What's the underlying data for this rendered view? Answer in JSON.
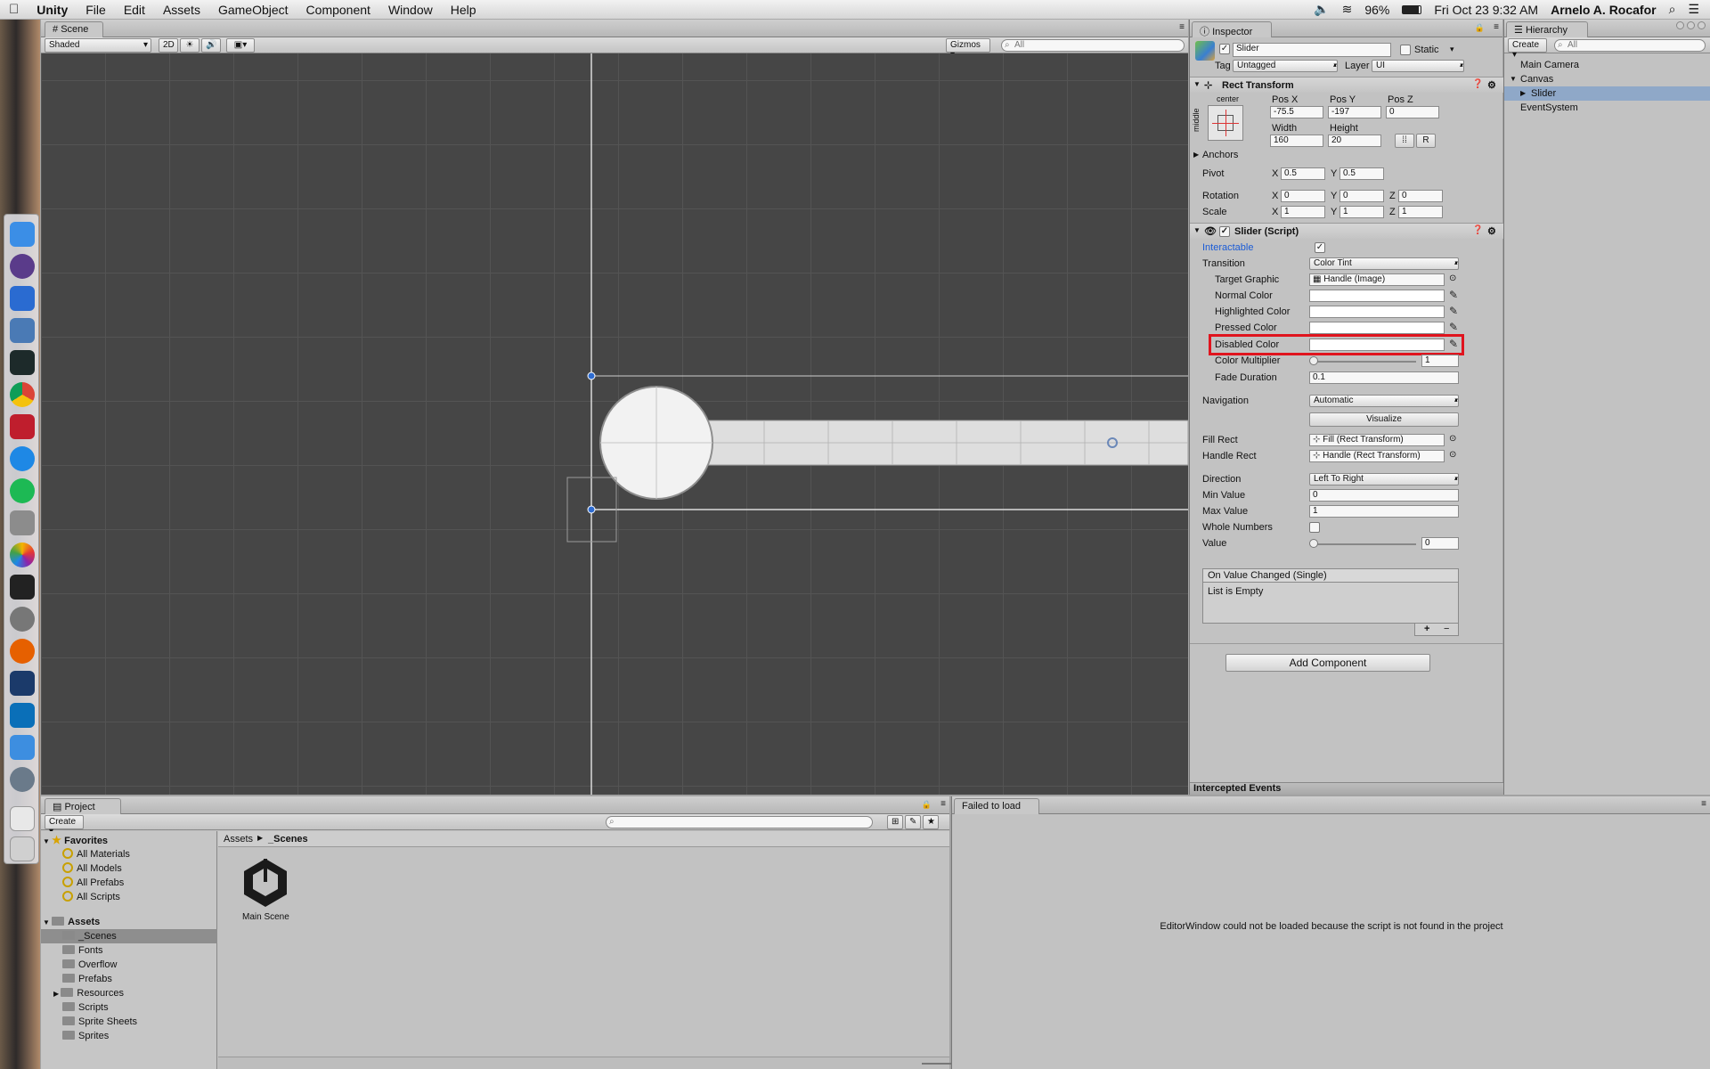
{
  "menubar": {
    "apple": "",
    "app": "Unity",
    "items": [
      "File",
      "Edit",
      "Assets",
      "GameObject",
      "Component",
      "Window",
      "Help"
    ],
    "battery": "96%",
    "datetime": "Fri Oct 23  9:32 AM",
    "user": "Arnelo A. Rocafor"
  },
  "scene": {
    "tab": "Scene",
    "shading": "Shaded",
    "mode_2d": "2D",
    "gizmos": "Gizmos",
    "search_placeholder": "All"
  },
  "inspector": {
    "tab": "Inspector",
    "object_name": "Slider",
    "static_label": "Static",
    "tag_label": "Tag",
    "tag_value": "Untagged",
    "layer_label": "Layer",
    "layer_value": "UI",
    "rect_transform": {
      "title": "Rect Transform",
      "anchor_h": "center",
      "anchor_v": "middle",
      "pos_x_label": "Pos X",
      "pos_x": "-75.5",
      "pos_y_label": "Pos Y",
      "pos_y": "-197",
      "pos_z_label": "Pos Z",
      "pos_z": "0",
      "width_label": "Width",
      "width": "160",
      "height_label": "Height",
      "height": "20",
      "r_button": "R",
      "anchors_label": "Anchors",
      "pivot_label": "Pivot",
      "pivot_x": "0.5",
      "pivot_y": "0.5",
      "rotation_label": "Rotation",
      "rot_x": "0",
      "rot_y": "0",
      "rot_z": "0",
      "scale_label": "Scale",
      "scale_x": "1",
      "scale_y": "1",
      "scale_z": "1",
      "x": "X",
      "y": "Y",
      "z": "Z"
    },
    "slider": {
      "title": "Slider (Script)",
      "interactable_label": "Interactable",
      "transition_label": "Transition",
      "transition_value": "Color Tint",
      "target_graphic_label": "Target Graphic",
      "target_graphic_value": "Handle (Image)",
      "normal_color_label": "Normal Color",
      "highlighted_color_label": "Highlighted Color",
      "pressed_color_label": "Pressed Color",
      "disabled_color_label": "Disabled Color",
      "color_multiplier_label": "Color Multiplier",
      "color_multiplier_value": "1",
      "fade_duration_label": "Fade Duration",
      "fade_duration_value": "0.1",
      "navigation_label": "Navigation",
      "navigation_value": "Automatic",
      "visualize_button": "Visualize",
      "fill_rect_label": "Fill Rect",
      "fill_rect_value": "Fill (Rect Transform)",
      "handle_rect_label": "Handle Rect",
      "handle_rect_value": "Handle (Rect Transform)",
      "direction_label": "Direction",
      "direction_value": "Left To Right",
      "min_value_label": "Min Value",
      "min_value": "0",
      "max_value_label": "Max Value",
      "max_value": "1",
      "whole_numbers_label": "Whole Numbers",
      "value_label": "Value",
      "value": "0",
      "event_title": "On Value Changed (Single)",
      "event_empty": "List is Empty",
      "plus": "+",
      "minus": "−"
    },
    "add_component": "Add Component",
    "intercepted_events": "Intercepted Events",
    "colors": {
      "highlight_box": "#e0141e",
      "interactable_blue": "#1a5bd6"
    }
  },
  "hierarchy": {
    "tab": "Hierarchy",
    "create": "Create",
    "search_placeholder": "All",
    "items": [
      "Main Camera",
      "Canvas",
      "Slider",
      "EventSystem"
    ]
  },
  "project": {
    "tab": "Project",
    "create": "Create",
    "favorites_label": "Favorites",
    "favorites": [
      "All Materials",
      "All Models",
      "All Prefabs",
      "All Scripts"
    ],
    "assets_label": "Assets",
    "folders": [
      "_Scenes",
      "Fonts",
      "Overflow",
      "Prefabs",
      "Resources",
      "Scripts",
      "Sprite Sheets",
      "Sprites"
    ],
    "breadcrumb_root": "Assets",
    "breadcrumb_leaf": "_Scenes",
    "asset_name": "Main Scene"
  },
  "failed_panel": {
    "tab": "Failed to load",
    "message": "EditorWindow could not be loaded because the script is not found in the project"
  }
}
